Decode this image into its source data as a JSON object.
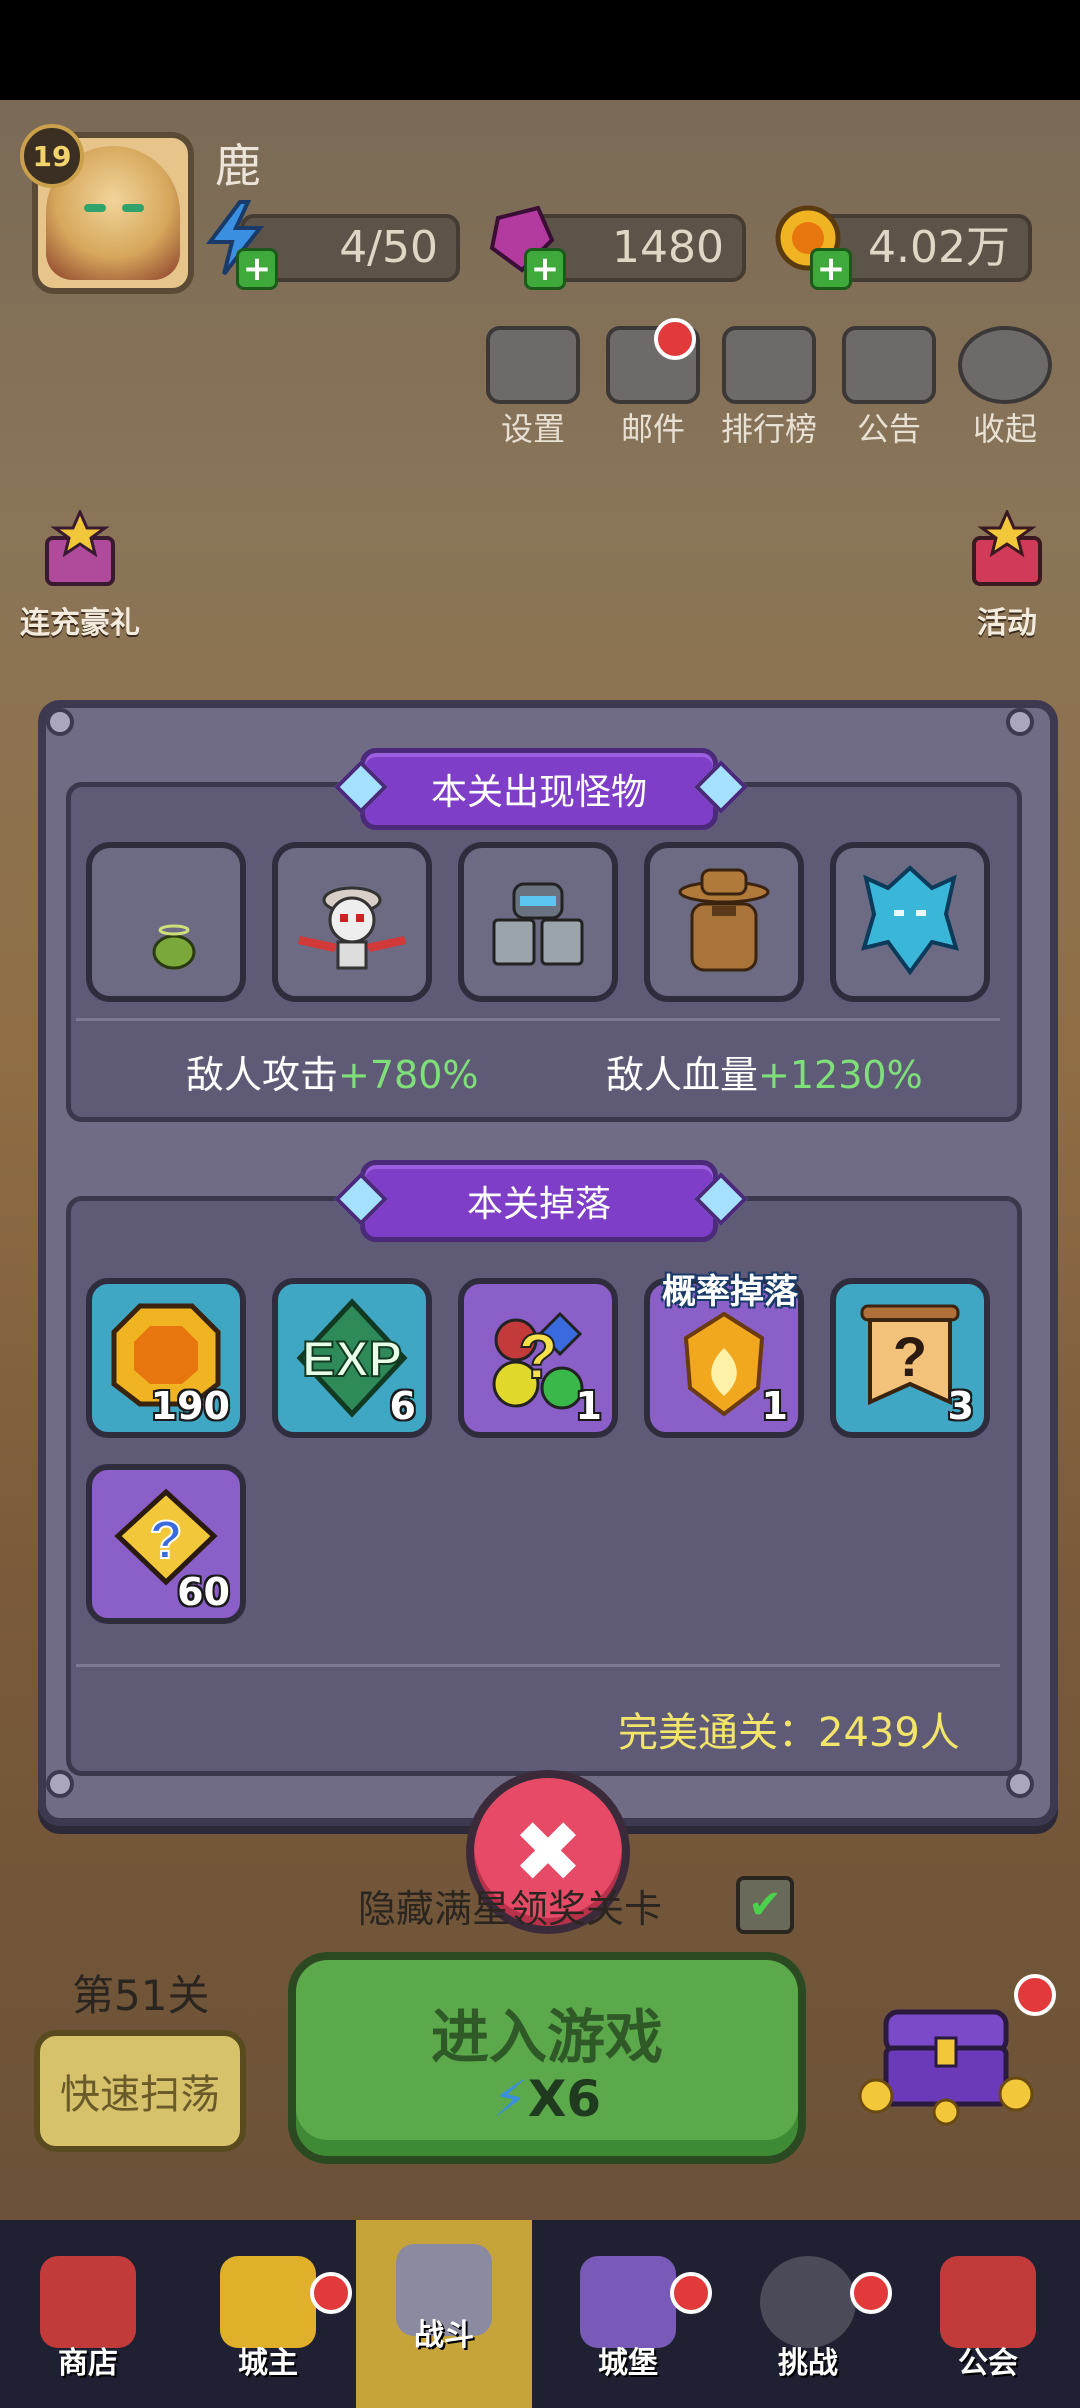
{
  "player": {
    "level": "19",
    "name": "鹿"
  },
  "resources": {
    "energy": "4/50",
    "gems": "1480",
    "gold": "4.02万"
  },
  "top_buttons": [
    "设置",
    "邮件",
    "排行榜",
    "公告",
    "收起"
  ],
  "side_buttons": {
    "left": "连充豪礼",
    "right": "活动"
  },
  "modal": {
    "monsters_title": "本关出现怪物",
    "enemy_attack_label": "敌人攻击",
    "enemy_attack_value": "+780%",
    "enemy_hp_label": "敌人血量",
    "enemy_hp_value": "+1230%",
    "drops_title": "本关掉落",
    "drops": [
      {
        "icon": "gold-coin-icon",
        "qty": "190"
      },
      {
        "icon": "exp-icon",
        "qty": "6"
      },
      {
        "icon": "mystery-gems-icon",
        "qty": "1"
      },
      {
        "icon": "fire-crystal-icon",
        "qty": "1",
        "tag": "概率掉落"
      },
      {
        "icon": "mystery-scroll-icon",
        "qty": "3"
      },
      {
        "icon": "puzzle-piece-icon",
        "qty": "60"
      }
    ],
    "perfect_clear": "完美通关：2439人"
  },
  "bottom": {
    "hide_text": "隐藏满星领奖关卡",
    "stage": "第51关",
    "sweep_label": "快速扫荡",
    "enter_label": "进入游戏",
    "enter_cost": "X6"
  },
  "nav": [
    "商店",
    "城主",
    "战斗",
    "城堡",
    "挑战",
    "公会"
  ],
  "colors": {
    "accent_purple": "#7e3ec7",
    "green_value": "#7fe07a",
    "close_red": "#e64a67"
  }
}
